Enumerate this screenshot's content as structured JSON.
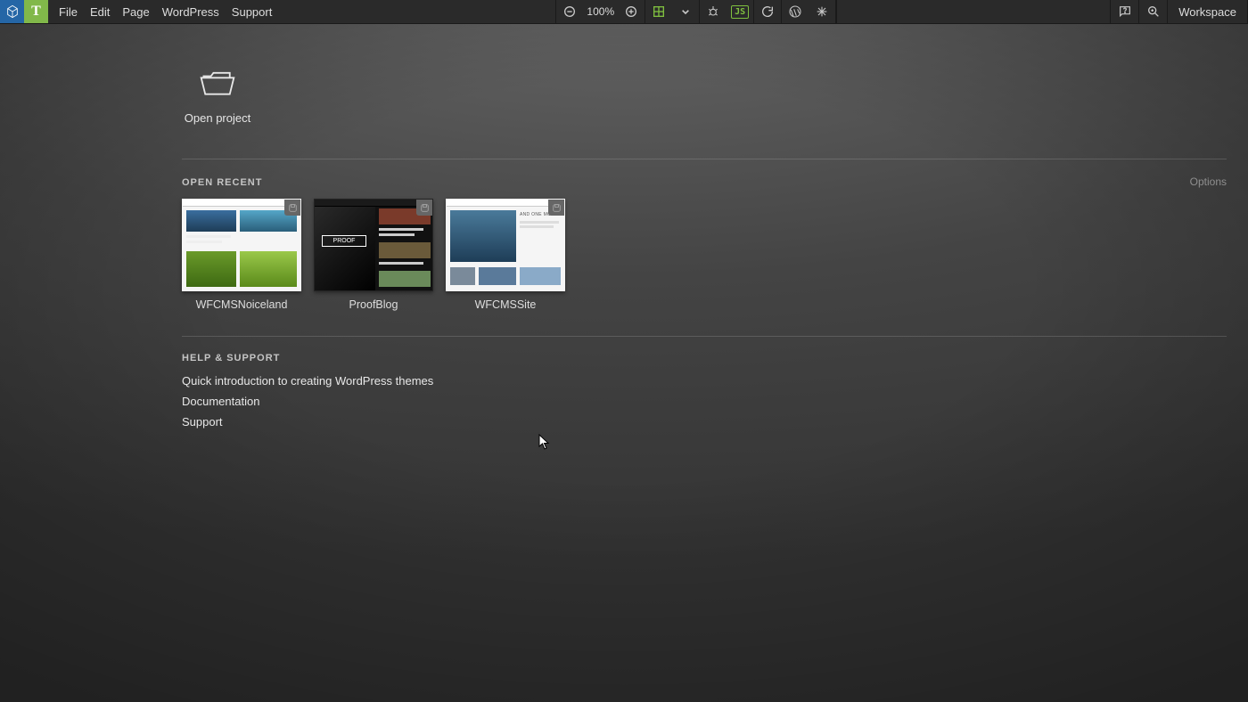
{
  "toolbar": {
    "menus": [
      "File",
      "Edit",
      "Page",
      "WordPress",
      "Support"
    ],
    "zoom": "100%",
    "workspace_label": "Workspace"
  },
  "open_project_label": "Open project",
  "recent": {
    "heading": "OPEN RECENT",
    "options_label": "Options",
    "projects": [
      {
        "name": "WFCMSNoiceland"
      },
      {
        "name": "ProofBlog"
      },
      {
        "name": "WFCMSSite"
      }
    ]
  },
  "help": {
    "heading": "HELP & SUPPORT",
    "links": [
      "Quick introduction to creating WordPress themes",
      "Documentation",
      "Support"
    ]
  },
  "thumb2_overlay": "PROOF",
  "thumb3_caption": "AND ONE MORE"
}
